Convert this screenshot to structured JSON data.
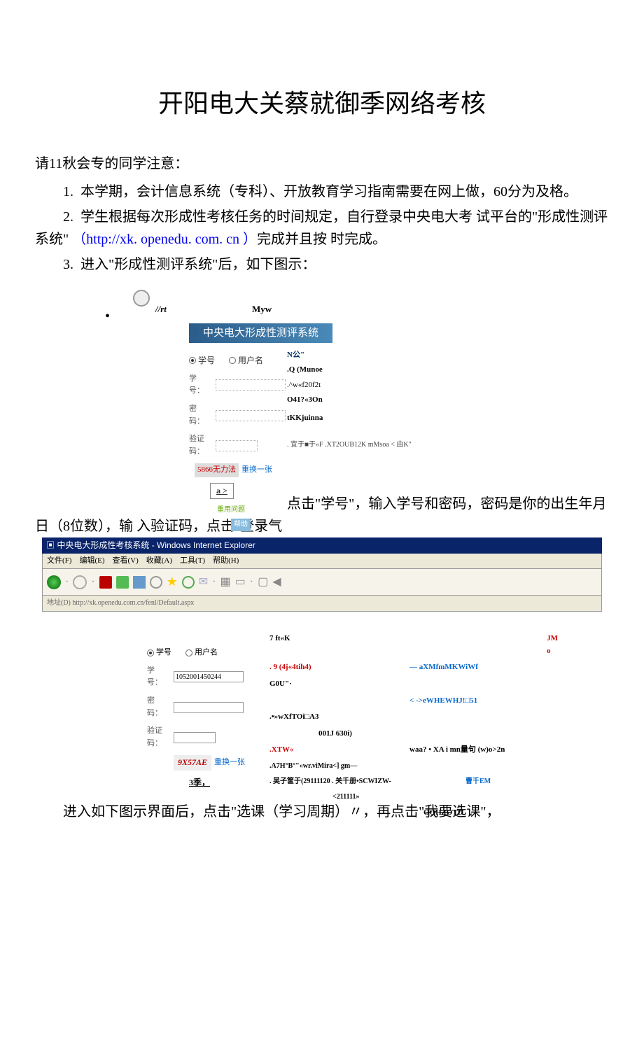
{
  "title": "开阳电大关蔡就御季网络考核",
  "intro": "请11秋会专的同学注意：",
  "paras": {
    "p1": "本学期，会计信息系统（专科）、开放教育学习指南需要在网上做，60分为及格。",
    "p2a": "学生根据每次形成性考核任务的时间规定，自行登录中央电大考 试平台的\"形成性测评系统\" ",
    "p2_link": "（http://xk. openedu. com. cn ）",
    "p2b": "完成并且按 时完成。",
    "p3": "进入\"形成性测评系统\"后，如下图示：",
    "after1": "点击\"学号\"，输入学号和密码，密码是你的出生年月日（8位数），输 入验证码，点击\"登录气",
    "after2": "进入如下图示界面后，点击\"选课（学习周期）〃，再点击\"我要选课\"，"
  },
  "nums": {
    "n1": "1.",
    "n2": "2.",
    "n3": "3."
  },
  "ss1": {
    "irt": "//rt",
    "myw": "Myw",
    "banner": "中央电大形成性测评系统",
    "r_student": "学号",
    "r_user": "用户名",
    "lbl_id": "学　号：",
    "lbl_pw": "密　码：",
    "lbl_cap": "验证码：",
    "captcha": "5866无力法",
    "change": "重换一张",
    "login": "a >",
    "tiny1": "重用问题",
    "tiny2": "帮助",
    "n_title": "N公\"",
    "r1": ".Q (Munoe",
    "r2": ".^w«f20f2t",
    "r3": "O41?«3On",
    "r4": "tKKjuinna",
    "foot": ". 宜于■于«F .XT2OUB12K mMsoa < 由K\""
  },
  "ie": {
    "title": "中央电大形成性考核系统 - Windows Internet Explorer",
    "menu": "文件(F)　编辑(E)　查看(V)　收藏(A)　工具(T)　帮助(H)",
    "addr": "地址(D) http://xk.openedu.com.cn/fenl/Default.aspx"
  },
  "ss2": {
    "h1": "7 ft«K",
    "jmo": "JM o",
    "r1a": ". 9 (4j«4tih4)",
    "r1b": "— aXMfmMKWiWf",
    "r2a": "G0U\"·",
    "r2b": "< ->eWHEWHJ!□51",
    "r3a": ".•»wXfTOi□A3",
    "r3b": "001J 630i)",
    "r4a": ".XTW«",
    "r4b": "waa? • XA i mn量句 (w)o>2n",
    "r5a": ".A7H°B°\"«wr.viMira<] gm—",
    "r6a": ". 吴子筐于(29111120 . 关千册•SCWIZW-",
    "r6b": "曹千EM",
    "r7": "<211111»",
    "r8": "OOH IOTD",
    "left": {
      "r_student": "学号",
      "r_user": "用户名",
      "lbl_id": "学　号：",
      "id_val": "1052001450244",
      "lbl_pw": "密　码：",
      "lbl_cap": "验证码：",
      "captcha": "9X57AE",
      "change": "重换一张",
      "three": "3季，"
    }
  }
}
